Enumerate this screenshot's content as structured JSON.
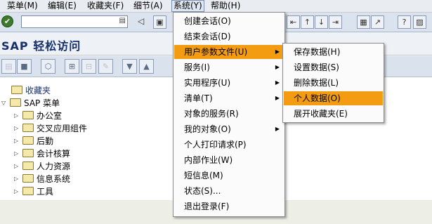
{
  "menubar": [
    {
      "label": "菜单(M)"
    },
    {
      "label": "编辑(E)"
    },
    {
      "label": "收藏夹(F)"
    },
    {
      "label": "细节(A)"
    },
    {
      "label": "系统(Y)"
    },
    {
      "label": "帮助(H)"
    }
  ],
  "title": "SAP 轻松访问",
  "tree": {
    "favorites": "收藏夹",
    "sap_menu": "SAP 菜单",
    "children": [
      "办公室",
      "交叉应用组件",
      "后勤",
      "会计核算",
      "人力资源",
      "信息系统",
      "工具"
    ]
  },
  "system_menu": {
    "items": [
      {
        "label": "创建会话(O)"
      },
      {
        "label": "结束会话(D)"
      },
      {
        "label": "用户参数文件(U)",
        "submenu": true,
        "highlighted": true
      },
      {
        "label": "服务(I)",
        "submenu": true
      },
      {
        "label": "实用程序(U)",
        "submenu": true
      },
      {
        "label": "清单(T)",
        "submenu": true
      },
      {
        "label": "对象的服务(R)"
      },
      {
        "label": "我的对象(O)",
        "submenu": true
      },
      {
        "label": "个人打印请求(P)"
      },
      {
        "label": "内部作业(W)"
      },
      {
        "label": "短信息(M)"
      },
      {
        "label": "状态(S)..."
      },
      {
        "label": "退出登录(F)"
      }
    ]
  },
  "user_profile_menu": {
    "items": [
      {
        "label": "保存数据(H)"
      },
      {
        "label": "设置数据(S)"
      },
      {
        "label": "删除数据(L)"
      },
      {
        "label": "个人数据(O)",
        "highlighted": true
      },
      {
        "label": "展开收藏夹(E)"
      }
    ]
  },
  "colors": {
    "highlight": "#f39c12",
    "title_text": "#17306b",
    "toolbar_bg": "#dbe3ee"
  }
}
